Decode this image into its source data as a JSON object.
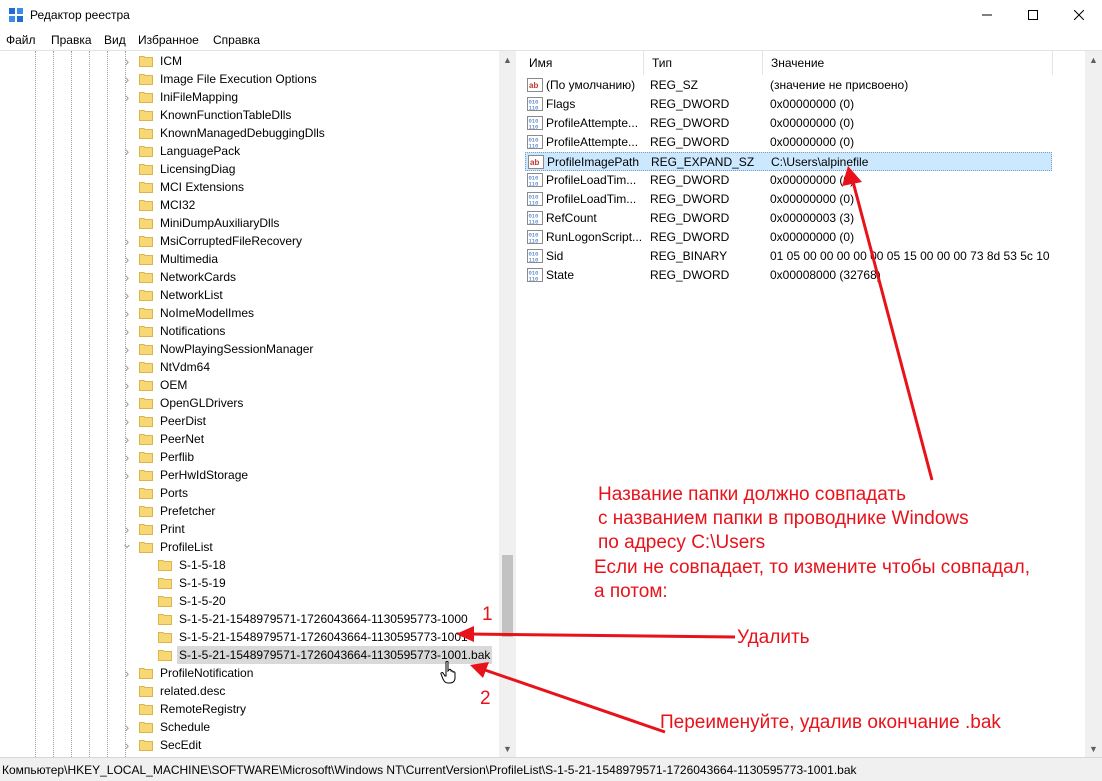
{
  "window": {
    "title": "Редактор реестра",
    "buttons": {
      "minimize": "minimize-icon",
      "maximize": "maximize-icon",
      "close": "close-icon"
    }
  },
  "menu": [
    "Файл",
    "Правка",
    "Вид",
    "Избранное",
    "Справка"
  ],
  "tree": {
    "items": [
      {
        "label": "ICM",
        "level": 1,
        "expander": "collapsed"
      },
      {
        "label": "Image File Execution Options",
        "level": 1,
        "expander": "collapsed"
      },
      {
        "label": "IniFileMapping",
        "level": 1,
        "expander": "collapsed"
      },
      {
        "label": "KnownFunctionTableDlls",
        "level": 1,
        "expander": "none"
      },
      {
        "label": "KnownManagedDebuggingDlls",
        "level": 1,
        "expander": "none"
      },
      {
        "label": "LanguagePack",
        "level": 1,
        "expander": "collapsed"
      },
      {
        "label": "LicensingDiag",
        "level": 1,
        "expander": "none"
      },
      {
        "label": "MCI Extensions",
        "level": 1,
        "expander": "none"
      },
      {
        "label": "MCI32",
        "level": 1,
        "expander": "none"
      },
      {
        "label": "MiniDumpAuxiliaryDlls",
        "level": 1,
        "expander": "none"
      },
      {
        "label": "MsiCorruptedFileRecovery",
        "level": 1,
        "expander": "collapsed"
      },
      {
        "label": "Multimedia",
        "level": 1,
        "expander": "collapsed"
      },
      {
        "label": "NetworkCards",
        "level": 1,
        "expander": "collapsed"
      },
      {
        "label": "NetworkList",
        "level": 1,
        "expander": "collapsed"
      },
      {
        "label": "NoImeModelImes",
        "level": 1,
        "expander": "collapsed"
      },
      {
        "label": "Notifications",
        "level": 1,
        "expander": "collapsed"
      },
      {
        "label": "NowPlayingSessionManager",
        "level": 1,
        "expander": "collapsed"
      },
      {
        "label": "NtVdm64",
        "level": 1,
        "expander": "collapsed"
      },
      {
        "label": "OEM",
        "level": 1,
        "expander": "collapsed"
      },
      {
        "label": "OpenGLDrivers",
        "level": 1,
        "expander": "collapsed"
      },
      {
        "label": "PeerDist",
        "level": 1,
        "expander": "collapsed"
      },
      {
        "label": "PeerNet",
        "level": 1,
        "expander": "collapsed"
      },
      {
        "label": "Perflib",
        "level": 1,
        "expander": "collapsed"
      },
      {
        "label": "PerHwIdStorage",
        "level": 1,
        "expander": "collapsed"
      },
      {
        "label": "Ports",
        "level": 1,
        "expander": "none"
      },
      {
        "label": "Prefetcher",
        "level": 1,
        "expander": "none"
      },
      {
        "label": "Print",
        "level": 1,
        "expander": "collapsed"
      },
      {
        "label": "ProfileList",
        "level": 1,
        "expander": "expanded"
      },
      {
        "label": "S-1-5-18",
        "level": 2,
        "expander": "none"
      },
      {
        "label": "S-1-5-19",
        "level": 2,
        "expander": "none"
      },
      {
        "label": "S-1-5-20",
        "level": 2,
        "expander": "none"
      },
      {
        "label": "S-1-5-21-1548979571-1726043664-1130595773-1000",
        "level": 2,
        "expander": "none"
      },
      {
        "label": "S-1-5-21-1548979571-1726043664-1130595773-1001",
        "level": 2,
        "expander": "none"
      },
      {
        "label": "S-1-5-21-1548979571-1726043664-1130595773-1001.bak",
        "level": 2,
        "expander": "none",
        "selected": true
      },
      {
        "label": "ProfileNotification",
        "level": 1,
        "expander": "collapsed"
      },
      {
        "label": "related.desc",
        "level": 1,
        "expander": "none"
      },
      {
        "label": "RemoteRegistry",
        "level": 1,
        "expander": "none"
      },
      {
        "label": "Schedule",
        "level": 1,
        "expander": "collapsed"
      },
      {
        "label": "SecEdit",
        "level": 1,
        "expander": "collapsed"
      }
    ]
  },
  "list": {
    "columns": [
      "Имя",
      "Тип",
      "Значение"
    ],
    "rows": [
      {
        "icon": "string-value-icon",
        "name": "(По умолчанию)",
        "type": "REG_SZ",
        "value": "(значение не присвоено)"
      },
      {
        "icon": "binary-value-icon",
        "name": "Flags",
        "type": "REG_DWORD",
        "value": "0x00000000 (0)"
      },
      {
        "icon": "binary-value-icon",
        "name": "ProfileAttempte...",
        "type": "REG_DWORD",
        "value": "0x00000000 (0)"
      },
      {
        "icon": "binary-value-icon",
        "name": "ProfileAttempte...",
        "type": "REG_DWORD",
        "value": "0x00000000 (0)"
      },
      {
        "icon": "string-value-icon",
        "name": "ProfileImagePath",
        "type": "REG_EXPAND_SZ",
        "value": "C:\\Users\\alpinefile",
        "selected": true
      },
      {
        "icon": "binary-value-icon",
        "name": "ProfileLoadTim...",
        "type": "REG_DWORD",
        "value": "0x00000000 (0)"
      },
      {
        "icon": "binary-value-icon",
        "name": "ProfileLoadTim...",
        "type": "REG_DWORD",
        "value": "0x00000000 (0)"
      },
      {
        "icon": "binary-value-icon",
        "name": "RefCount",
        "type": "REG_DWORD",
        "value": "0x00000003 (3)"
      },
      {
        "icon": "binary-value-icon",
        "name": "RunLogonScript...",
        "type": "REG_DWORD",
        "value": "0x00000000 (0)"
      },
      {
        "icon": "binary-value-icon",
        "name": "Sid",
        "type": "REG_BINARY",
        "value": "01 05 00 00 00 00 00 05 15 00 00 00 73 8d 53 5c 10 5..."
      },
      {
        "icon": "binary-value-icon",
        "name": "State",
        "type": "REG_DWORD",
        "value": "0x00008000 (32768)"
      }
    ]
  },
  "status": "Компьютер\\HKEY_LOCAL_MACHINE\\SOFTWARE\\Microsoft\\Windows NT\\CurrentVersion\\ProfileList\\S-1-5-21-1548979571-1726043664-1130595773-1001.bak",
  "annotations": {
    "note_lines": [
      "Название папки должно совпадать",
      "с названием папки в проводнике Windows",
      "по адресу C:\\Users",
      "Если не совпадает, то измените чтобы совпадал,",
      "а потом:"
    ],
    "delete_label": "Удалить",
    "rename_label": "Переименуйте, удалив окончание .bak",
    "marker_1": "1",
    "marker_2": "2",
    "color": "#e8121b"
  },
  "colors": {
    "folder": "#f8d775",
    "folder_edge": "#dcb44a",
    "selection": "#cce8ff",
    "tree_selection": "#d9d9d9",
    "annotation": "#e8121b"
  }
}
